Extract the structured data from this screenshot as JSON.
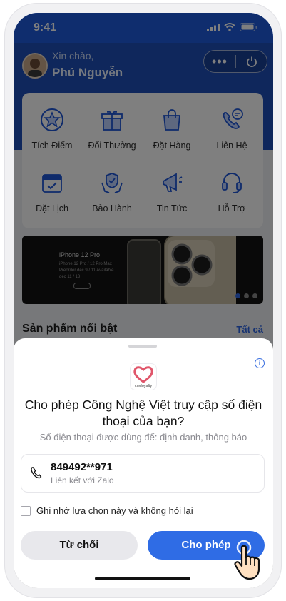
{
  "status_bar": {
    "time": "9:41"
  },
  "header": {
    "greeting": "Xin chào,",
    "user_name": "Phú Nguyễn",
    "menu_dots": "•••"
  },
  "menu": {
    "items": [
      {
        "label": "Tích Điểm",
        "icon": "star-badge-icon"
      },
      {
        "label": "Đổi Thưởng",
        "icon": "gift-icon"
      },
      {
        "label": "Đặt Hàng",
        "icon": "shopping-bag-icon"
      },
      {
        "label": "Liên Hệ",
        "icon": "phone-chat-icon"
      },
      {
        "label": "Đặt Lịch",
        "icon": "calendar-check-icon"
      },
      {
        "label": "Bảo Hành",
        "icon": "shield-hands-icon"
      },
      {
        "label": "Tin Tức",
        "icon": "megaphone-icon"
      },
      {
        "label": "Hỗ Trợ",
        "icon": "headset-icon"
      }
    ]
  },
  "banner": {
    "title": "iPhone 12 Pro",
    "lines": "iPhone 12 Pro / 12 Pro Max Preorder dec 9 / 11 Available dec 11 / 13"
  },
  "featured": {
    "title": "Sản phẩm nổi bật",
    "see_all": "Tất cả"
  },
  "dialog": {
    "app_logo_text": "cnvloyalty",
    "title": "Cho phép Công Nghệ Việt truy cập số điện thoại của bạn?",
    "subtitle": "Số điện thoại được dùng để: định danh, thông báo",
    "phone_number": "849492**971",
    "phone_link_text": "Liên kết với Zalo",
    "remember_label": "Ghi nhớ lựa chọn này và không hỏi lại",
    "deny_label": "Từ chối",
    "allow_label": "Cho phép"
  },
  "colors": {
    "primary": "#2f6ce5",
    "header_blue": "#1e5bdc",
    "brand_pink": "#e0566b"
  }
}
